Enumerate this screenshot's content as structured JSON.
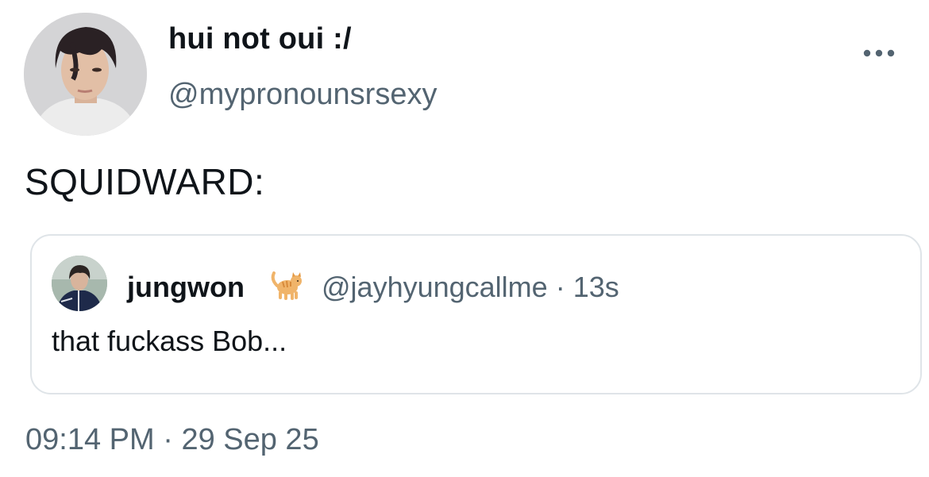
{
  "tweet": {
    "display_name": "hui not oui :/",
    "handle": "@mypronounsrsexy",
    "text": "SQUIDWARD:",
    "time": "09:14 PM",
    "date": "29 Sep 25",
    "separator": "·"
  },
  "quoted_tweet": {
    "display_name": "jungwon",
    "emoji_icon": "cat-emoji-icon",
    "handle": "@jayhyungcallme",
    "separator": "·",
    "age": "13s",
    "text": "that fuckass Bob..."
  },
  "icons": {
    "more": "more-horizontal-icon"
  },
  "colors": {
    "text_primary": "#0f1419",
    "text_secondary": "#536471",
    "border": "#dfe4e8",
    "background": "#ffffff"
  }
}
